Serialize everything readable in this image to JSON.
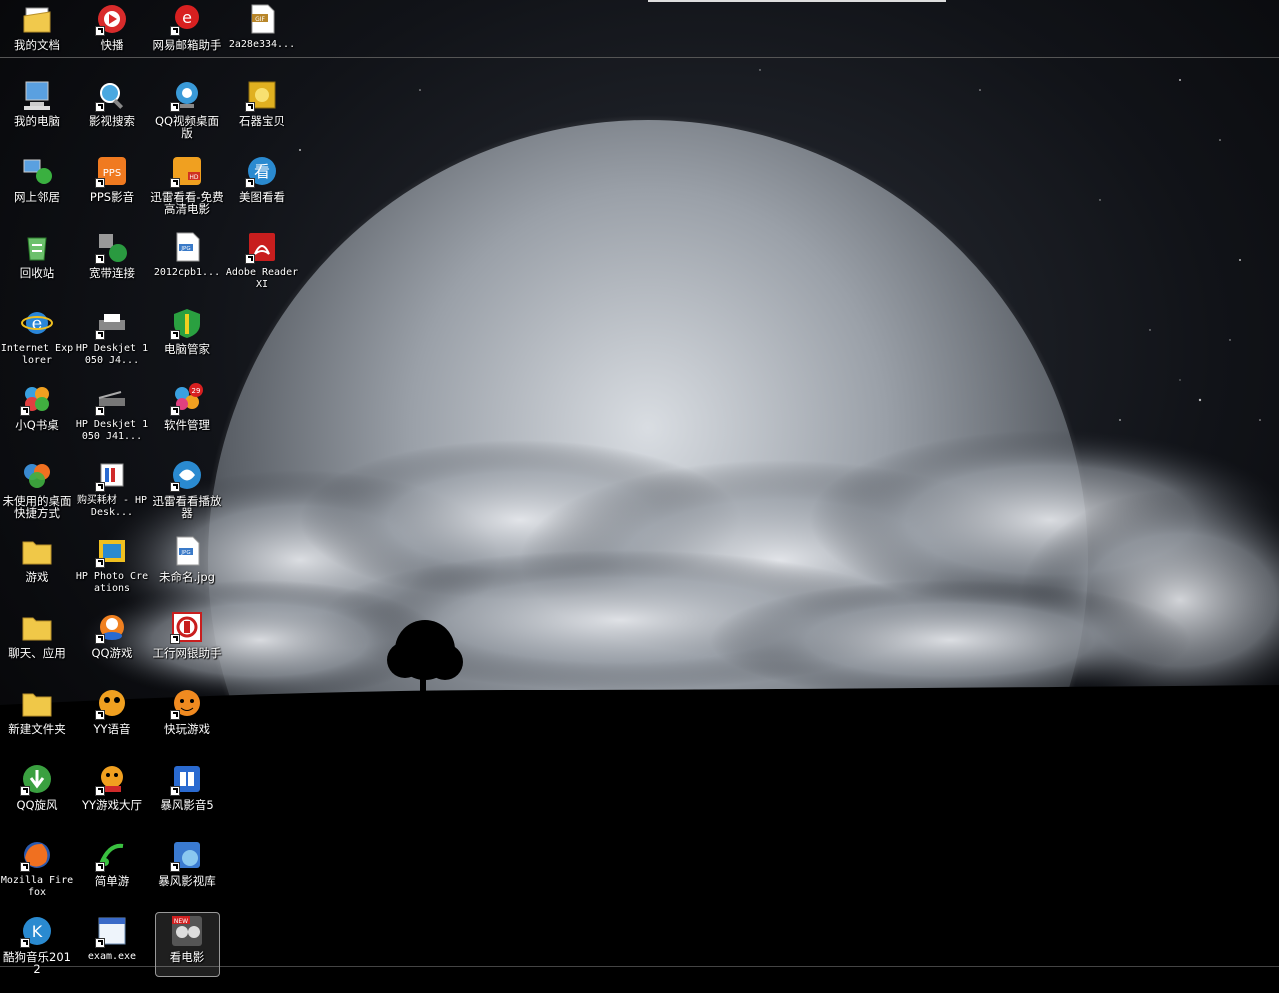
{
  "desktop": {
    "icons": [
      {
        "label": "我的文档",
        "icon": "my-documents-icon",
        "shortcut": false
      },
      {
        "label": "快播",
        "icon": "qvod-icon",
        "shortcut": true
      },
      {
        "label": "网易邮箱助手",
        "icon": "netease-mail-icon",
        "shortcut": true
      },
      {
        "label": "2a28e334...",
        "icon": "gif-file-icon",
        "shortcut": false
      },
      {
        "label": "我的电脑",
        "icon": "my-computer-icon",
        "shortcut": false
      },
      {
        "label": "影视搜索",
        "icon": "video-search-icon",
        "shortcut": true
      },
      {
        "label": "QQ视频桌面版",
        "icon": "qq-video-icon",
        "shortcut": true
      },
      {
        "label": "石器宝贝",
        "icon": "stone-game-icon",
        "shortcut": true
      },
      {
        "label": "网上邻居",
        "icon": "network-icon",
        "shortcut": false
      },
      {
        "label": "PPS影音",
        "icon": "pps-icon",
        "shortcut": true
      },
      {
        "label": "迅雷看看-免费高清电影",
        "icon": "xunlei-kankan-icon",
        "shortcut": true
      },
      {
        "label": "美图看看",
        "icon": "meitu-viewer-icon",
        "shortcut": true
      },
      {
        "label": "回收站",
        "icon": "recycle-bin-icon",
        "shortcut": false
      },
      {
        "label": "宽带连接",
        "icon": "broadband-icon",
        "shortcut": true
      },
      {
        "label": "2012cpb1...",
        "icon": "jpg-file-icon",
        "shortcut": false
      },
      {
        "label": "Adobe Reader XI",
        "icon": "adobe-reader-icon",
        "shortcut": true
      },
      {
        "label": "Internet Explorer",
        "icon": "internet-explorer-icon",
        "shortcut": false
      },
      {
        "label": "HP Deskjet 1050 J4...",
        "icon": "printer-icon",
        "shortcut": true
      },
      {
        "label": "电脑管家",
        "icon": "pc-manager-icon",
        "shortcut": true
      },
      {
        "label": "小Q书桌",
        "icon": "xiaoq-desk-icon",
        "shortcut": true
      },
      {
        "label": "HP Deskjet 1050 J41...",
        "icon": "scanner-icon",
        "shortcut": true
      },
      {
        "label": "软件管理",
        "icon": "software-manager-icon",
        "shortcut": true
      },
      {
        "label": "未使用的桌面快捷方式",
        "icon": "unused-shortcuts-icon",
        "shortcut": false
      },
      {
        "label": "购买耗材 - HP Desk...",
        "icon": "hp-supplies-icon",
        "shortcut": true
      },
      {
        "label": "迅雷看看播放器",
        "icon": "xunlei-player-icon",
        "shortcut": true
      },
      {
        "label": "游戏",
        "icon": "folder-icon",
        "shortcut": false
      },
      {
        "label": "HP Photo Creations",
        "icon": "hp-photo-icon",
        "shortcut": true
      },
      {
        "label": "未命名.jpg",
        "icon": "jpg-file-icon",
        "shortcut": false
      },
      {
        "label": "聊天、应用",
        "icon": "folder-icon",
        "shortcut": false
      },
      {
        "label": "QQ游戏",
        "icon": "qq-game-icon",
        "shortcut": true
      },
      {
        "label": "工行网银助手",
        "icon": "icbc-icon",
        "shortcut": true
      },
      {
        "label": "新建文件夹",
        "icon": "folder-icon",
        "shortcut": false
      },
      {
        "label": "YY语音",
        "icon": "yy-voice-icon",
        "shortcut": true
      },
      {
        "label": "快玩游戏",
        "icon": "kuaiwan-icon",
        "shortcut": true
      },
      {
        "label": "QQ旋风",
        "icon": "qq-whirlwind-icon",
        "shortcut": true
      },
      {
        "label": "YY游戏大厅",
        "icon": "yy-game-icon",
        "shortcut": true
      },
      {
        "label": "暴风影音5",
        "icon": "baofeng-icon",
        "shortcut": true
      },
      {
        "label": "Mozilla Firefox",
        "icon": "firefox-icon",
        "shortcut": true
      },
      {
        "label": "简单游",
        "icon": "jiandanyou-icon",
        "shortcut": true
      },
      {
        "label": "暴风影视库",
        "icon": "baofeng-library-icon",
        "shortcut": true
      },
      {
        "label": "酷狗音乐2012",
        "icon": "kugou-icon",
        "shortcut": true
      },
      {
        "label": "exam.exe",
        "icon": "exe-icon",
        "shortcut": true
      },
      {
        "label": "看电影",
        "icon": "watch-movie-icon",
        "shortcut": false,
        "badge": "NEW"
      }
    ]
  },
  "colors": {
    "background": "#000000",
    "label_text": "#ffffff",
    "wallpaper_sky": "#0b0b10"
  }
}
